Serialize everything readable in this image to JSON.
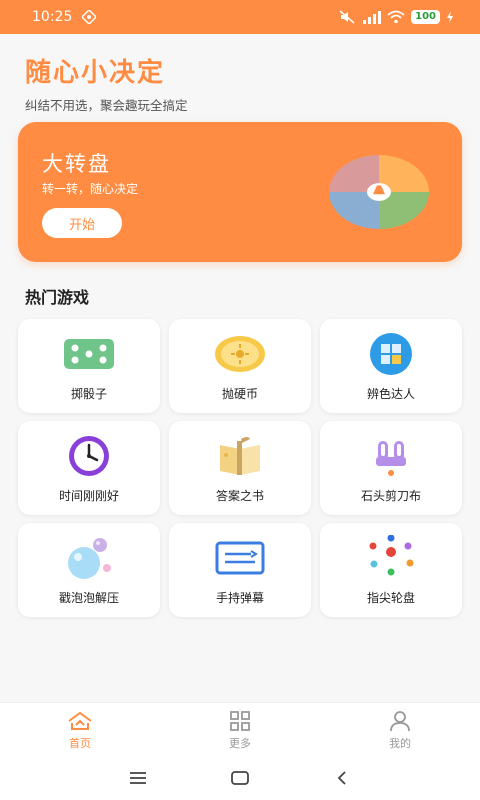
{
  "status": {
    "time": "10:25",
    "battery": "100"
  },
  "header": {
    "title": "随心小决定",
    "subtitle": "纠结不用选，聚会趣玩全搞定"
  },
  "hero": {
    "title": "大转盘",
    "desc": "转一转，随心决定",
    "button": "开始"
  },
  "section": {
    "hot_games": "热门游戏"
  },
  "games": [
    {
      "label": "掷骰子",
      "icon": "dice-icon"
    },
    {
      "label": "抛硬币",
      "icon": "coin-icon"
    },
    {
      "label": "辨色达人",
      "icon": "color-grid-icon"
    },
    {
      "label": "时间刚刚好",
      "icon": "clock-icon"
    },
    {
      "label": "答案之书",
      "icon": "book-icon"
    },
    {
      "label": "石头剪刀布",
      "icon": "rock-paper-scissors-icon"
    },
    {
      "label": "戳泡泡解压",
      "icon": "bubbles-icon"
    },
    {
      "label": "手持弹幕",
      "icon": "barrage-icon"
    },
    {
      "label": "指尖轮盘",
      "icon": "fingertip-wheel-icon"
    }
  ],
  "tabs": [
    {
      "label": "首页",
      "icon": "home-icon",
      "active": true
    },
    {
      "label": "更多",
      "icon": "grid-icon",
      "active": false
    },
    {
      "label": "我的",
      "icon": "person-icon",
      "active": false
    }
  ],
  "colors": {
    "accent": "#ff8c42",
    "background": "#f7f7f7"
  }
}
